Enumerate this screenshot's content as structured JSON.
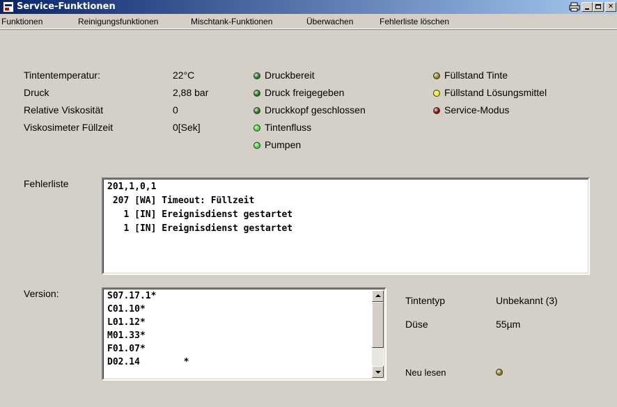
{
  "window": {
    "title": "Service-Funktionen"
  },
  "menu": [
    "Funktionen",
    "Reinigungsfunktionen",
    "Mischtank-Funktionen",
    "Überwachen",
    "Fehlerliste löschen"
  ],
  "readings": [
    {
      "label": "Tintentemperatur:",
      "value": "22°C"
    },
    {
      "label": "Druck",
      "value": "2,88 bar"
    },
    {
      "label": "Relative Viskosität",
      "value": "0"
    },
    {
      "label": "Viskosimeter Füllzeit",
      "value": "0[Sek]"
    }
  ],
  "status_col1": [
    {
      "label": "Druckbereit",
      "color": "#1f7a12"
    },
    {
      "label": "Druck freigegeben",
      "color": "#1f7a12"
    },
    {
      "label": "Druckkopf geschlossen",
      "color": "#1f7a12"
    },
    {
      "label": "Tintenfluss",
      "color": "#33e033"
    },
    {
      "label": "Pumpen",
      "color": "#33e033"
    }
  ],
  "status_col2": [
    {
      "label": "Füllstand Tinte",
      "color": "#8b7d1a"
    },
    {
      "label": "Füllstand Lösungsmittel",
      "color": "#f5f000"
    },
    {
      "label": "Service-Modus",
      "color": "#8b0000"
    }
  ],
  "fehlerliste": {
    "label": "Fehlerliste",
    "lines": [
      "201,1,0,1",
      " 207 [WA] Timeout: Füllzeit",
      "   1 [IN] Ereignisdienst gestartet",
      "   1 [IN] Ereignisdienst gestartet"
    ]
  },
  "version": {
    "label": "Version:",
    "lines": [
      "S07.17.1*",
      "C01.10*",
      "L01.12*",
      "M01.33*",
      "F01.07*",
      "D02.14        *"
    ]
  },
  "info": [
    {
      "label": "Tintentyp",
      "value": "Unbekannt (3)"
    },
    {
      "label": "Düse",
      "value": "55µm"
    }
  ],
  "neu_lesen": {
    "label": "Neu lesen",
    "color": "#8b7d1a"
  }
}
